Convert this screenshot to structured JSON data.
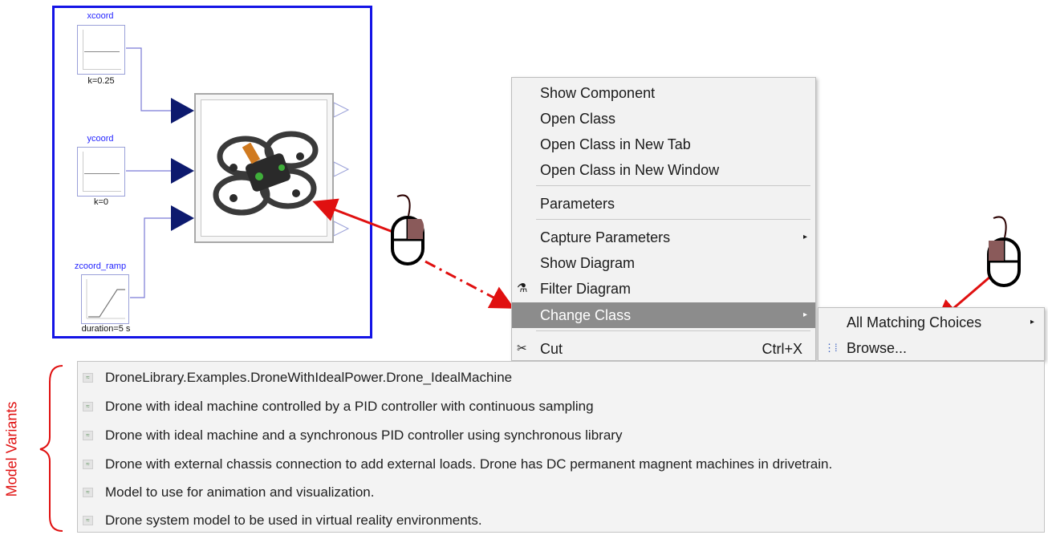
{
  "diagram": {
    "blocks": [
      {
        "name": "xcoord",
        "param": "k=0.25"
      },
      {
        "name": "ycoord",
        "param": "k=0"
      },
      {
        "name": "zcoord_ramp",
        "param": "duration=5 s"
      }
    ]
  },
  "context_menu": {
    "items": [
      {
        "label": "Show Component"
      },
      {
        "label": "Open Class"
      },
      {
        "label": "Open Class in New Tab"
      },
      {
        "label": "Open Class in New Window"
      },
      {
        "label": "Parameters"
      },
      {
        "label": "Capture Parameters"
      },
      {
        "label": "Show Diagram"
      },
      {
        "label": "Filter Diagram"
      },
      {
        "label": "Change Class"
      },
      {
        "label": "Cut",
        "shortcut": "Ctrl+X"
      }
    ],
    "submenu": [
      {
        "label": "All Matching Choices"
      },
      {
        "label": "Browse..."
      }
    ]
  },
  "variants": {
    "side_label": "Model Variants",
    "items": [
      {
        "label": "DroneLibrary.Examples.DroneWithIdealPower.Drone_IdealMachine"
      },
      {
        "label": "Drone with ideal machine controlled by a PID controller with continuous sampling"
      },
      {
        "label": "Drone with ideal machine and a synchronous PID controller using synchronous library"
      },
      {
        "label": "Drone with external chassis connection to add external loads. Drone has DC permanent magnent machines in drivetrain."
      },
      {
        "label": "Model to use for animation and visualization."
      },
      {
        "label": " Drone system model to be used in virtual reality environments."
      }
    ]
  },
  "colors": {
    "annotation_red": "#e01010",
    "diagram_border": "#1414e6",
    "connector_navy": "#0d1a6e",
    "menu_selected": "#8c8c8c"
  }
}
